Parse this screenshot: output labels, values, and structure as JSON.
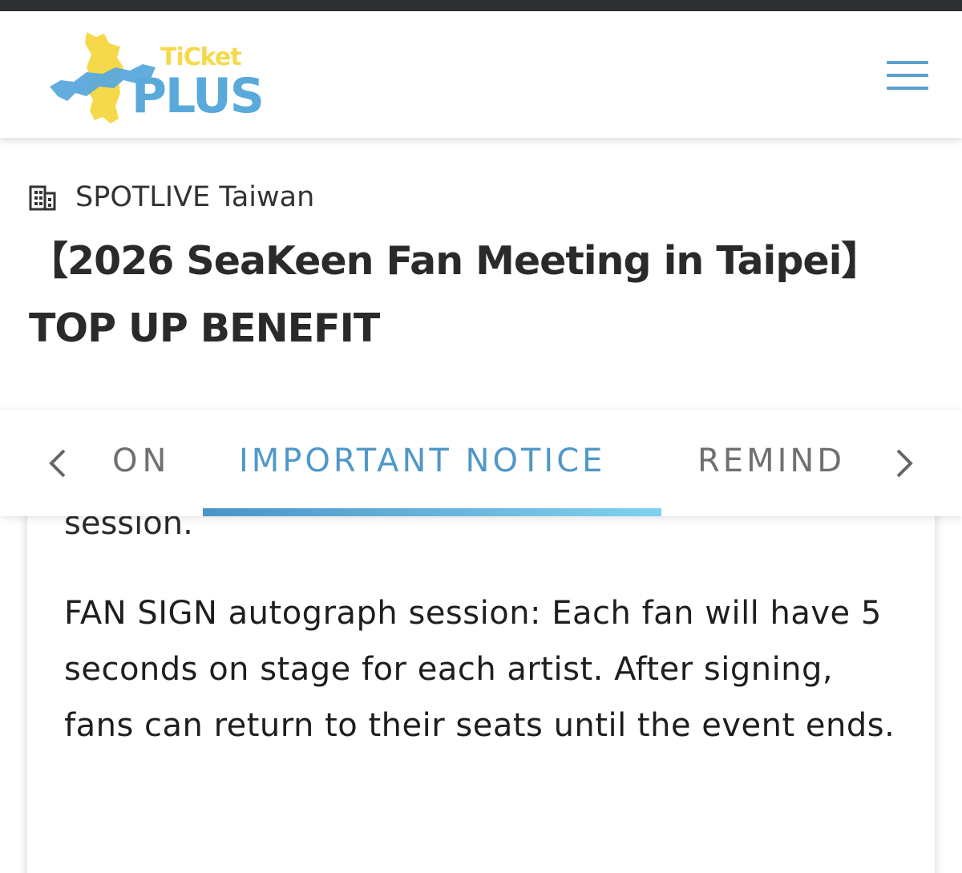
{
  "header": {
    "logo_word_small": "TiCket",
    "logo_word_big": "PLUS",
    "colors": {
      "logo_yellow": "#f6d94a",
      "logo_blue": "#5aa9db",
      "accent": "#4f98c8"
    },
    "menu_icon": "hamburger-menu-icon"
  },
  "event": {
    "organizer_icon": "building-icon",
    "organizer": "SPOTLIVE Taiwan",
    "title_line1": "【2026 SeaKeen Fan Meeting in Taipei】",
    "title_line2": "TOP UP BENEFIT"
  },
  "tabs": {
    "prev_icon": "chevron-left-icon",
    "next_icon": "chevron-right-icon",
    "items": [
      {
        "label": "ON",
        "active": false
      },
      {
        "label": "IMPORTANT NOTICE",
        "active": true
      },
      {
        "label": "REMIND",
        "active": false
      }
    ]
  },
  "content": {
    "clipped_text": "session.",
    "paragraph": "FAN SIGN autograph session: Each fan will have 5 seconds on stage for each artist. After signing, fans can return to their seats until the event ends."
  }
}
